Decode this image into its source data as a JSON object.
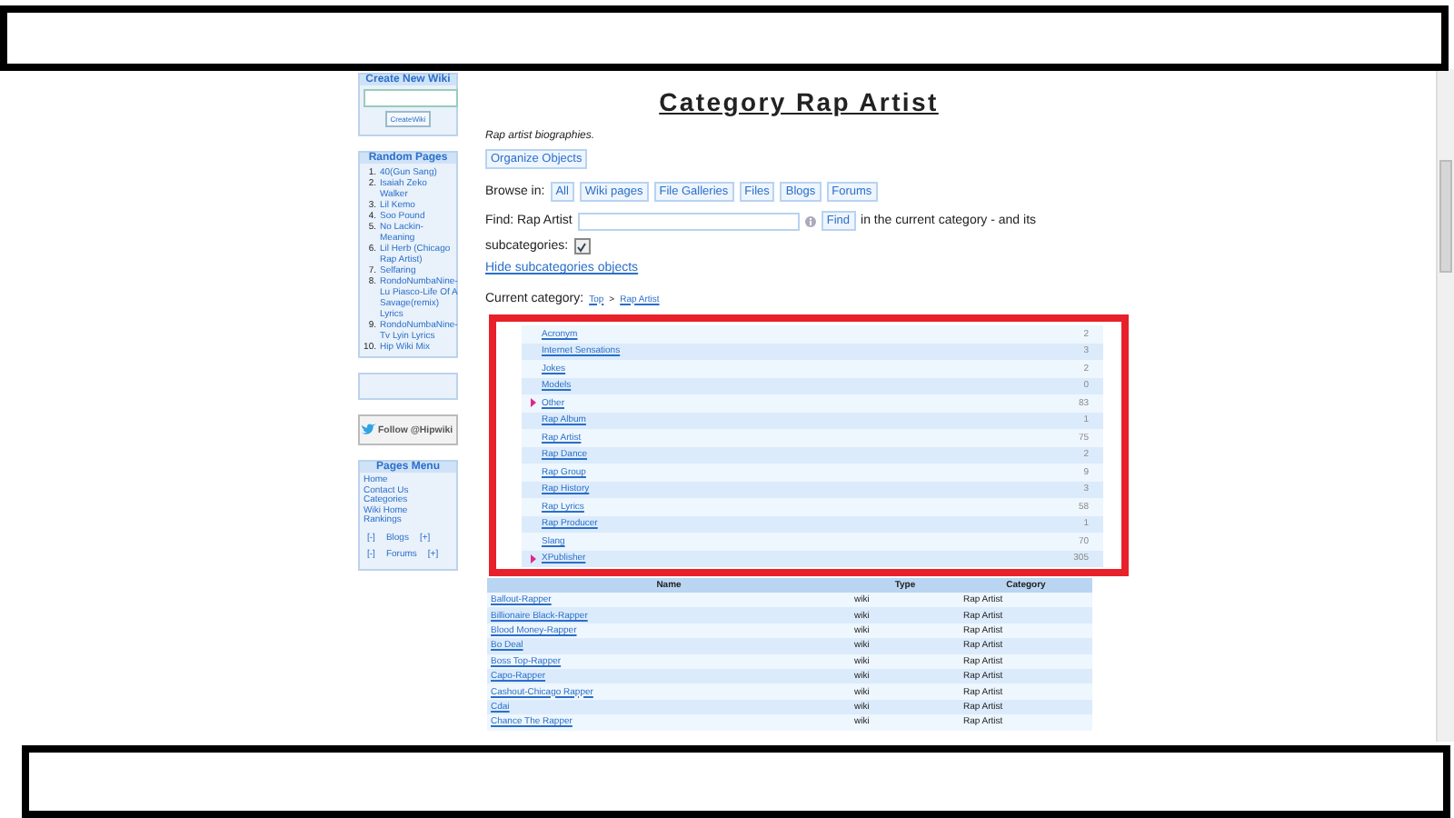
{
  "sidebar": {
    "create_wiki": {
      "title": "Create New Wiki",
      "button": "CreateWiki"
    },
    "random_pages": {
      "title": "Random Pages",
      "items": [
        {
          "number": "1.",
          "title": "40(Gun Sang)"
        },
        {
          "number": "2.",
          "title": "Isaiah Zeko Walker"
        },
        {
          "number": "3.",
          "title": "Lil Kemo"
        },
        {
          "number": "4.",
          "title": "Soo Pound"
        },
        {
          "number": "5.",
          "title": "No Lackin-Meaning"
        },
        {
          "number": "6.",
          "title": "Lil Herb (Chicago Rap Artist)"
        },
        {
          "number": "7.",
          "title": "Selfaring"
        },
        {
          "number": "8.",
          "title": "RondoNumbaNine-Lu Piasco-Life Of A Savage(remix) Lyrics"
        },
        {
          "number": "9.",
          "title": "RondoNumbaNine-Tv Lyin Lyrics"
        },
        {
          "number": "10.",
          "title": "Hip Wiki Mix"
        }
      ]
    },
    "follow": {
      "label": "Follow @Hipwiki"
    },
    "pages_menu": {
      "title": "Pages Menu",
      "links": [
        "Home",
        "Contact Us",
        "Categories",
        "Wiki Home",
        "Rankings"
      ],
      "toggles": [
        {
          "collapse": "[-]",
          "label": "Blogs",
          "expand": "[+]"
        },
        {
          "collapse": "[-]",
          "label": "Forums",
          "expand": "[+]"
        }
      ]
    }
  },
  "page": {
    "title": "Category Rap Artist",
    "description": "Rap artist biographies.",
    "organize_button": "Organize Objects",
    "browse": {
      "label": "Browse in:",
      "buttons": [
        "All",
        "Wiki pages",
        "File Galleries",
        "Files",
        "Blogs",
        "Forums"
      ]
    },
    "find": {
      "label": "Find: Rap Artist",
      "button": "Find",
      "suffix": "in the current category - and its",
      "subcategories_label": "subcategories:",
      "subcategories_checked": true
    },
    "hide_link": "Hide subcategories objects",
    "current_category": {
      "label": "Current category:",
      "path": [
        "Top",
        "Rap Artist"
      ],
      "separator": ">"
    },
    "subcategories": [
      {
        "name": "Acronym",
        "count": "2",
        "has_children": false
      },
      {
        "name": "Internet Sensations",
        "count": "3",
        "has_children": false
      },
      {
        "name": "Jokes",
        "count": "2",
        "has_children": false
      },
      {
        "name": "Models",
        "count": "0",
        "has_children": false
      },
      {
        "name": "Other",
        "count": "83",
        "has_children": true
      },
      {
        "name": "Rap Album",
        "count": "1",
        "has_children": false
      },
      {
        "name": "Rap Artist",
        "count": "75",
        "has_children": false
      },
      {
        "name": "Rap Dance",
        "count": "2",
        "has_children": false
      },
      {
        "name": "Rap Group",
        "count": "9",
        "has_children": false
      },
      {
        "name": "Rap History",
        "count": "3",
        "has_children": false
      },
      {
        "name": "Rap Lyrics",
        "count": "58",
        "has_children": false
      },
      {
        "name": "Rap Producer",
        "count": "1",
        "has_children": false
      },
      {
        "name": "Slang",
        "count": "70",
        "has_children": false
      },
      {
        "name": "XPublisher",
        "count": "305",
        "has_children": true
      }
    ],
    "objects": {
      "columns": [
        "Name",
        "Type",
        "Category"
      ],
      "rows": [
        [
          "Ballout-Rapper",
          "wiki",
          "Rap Artist"
        ],
        [
          "Billionaire Black-Rapper",
          "wiki",
          "Rap Artist"
        ],
        [
          "Blood Money-Rapper",
          "wiki",
          "Rap Artist"
        ],
        [
          "Bo Deal",
          "wiki",
          "Rap Artist"
        ],
        [
          "Boss Top-Rapper",
          "wiki",
          "Rap Artist"
        ],
        [
          "Capo-Rapper",
          "wiki",
          "Rap Artist"
        ],
        [
          "Cashout-Chicago Rapper",
          "wiki",
          "Rap Artist"
        ],
        [
          "Cdai",
          "wiki",
          "Rap Artist"
        ],
        [
          "Chance The Rapper",
          "wiki",
          "Rap Artist"
        ]
      ]
    }
  }
}
